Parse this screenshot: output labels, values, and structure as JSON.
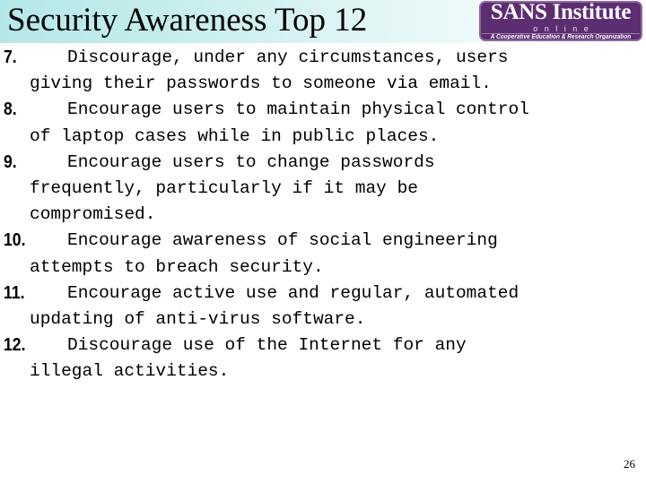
{
  "slide": {
    "title": "Security Awareness Top 12",
    "page_number": "26"
  },
  "logo": {
    "wordmark": "SANS Institute",
    "subtitle": "online",
    "tagline": "A Cooperative Education & Research Organization",
    "background_color": "#5c2d70",
    "border_color": "#8e6aa0",
    "text_color": "#ffffff"
  },
  "theme": {
    "title_gradient_start": "#b4e8e8",
    "title_gradient_end": "#fdffff",
    "body_text_color": "#000000",
    "background_color": "#ffffff"
  },
  "items": [
    {
      "number": "7.",
      "lines": [
        "Discourage, under any circumstances, users",
        "giving their passwords to someone via email."
      ]
    },
    {
      "number": "8.",
      "lines": [
        "Encourage users to maintain physical control",
        "of laptop cases while in public places."
      ]
    },
    {
      "number": "9.",
      "lines": [
        "Encourage users to change passwords",
        "frequently, particularly if it may be",
        "compromised."
      ]
    },
    {
      "number": "10.",
      "lines": [
        "Encourage awareness of social engineering",
        "attempts to breach security."
      ]
    },
    {
      "number": "11.",
      "lines": [
        "Encourage active use and regular, automated",
        "updating of anti-virus software."
      ]
    },
    {
      "number": "12.",
      "lines": [
        "Discourage use of the Internet for any",
        "illegal activities."
      ]
    }
  ]
}
